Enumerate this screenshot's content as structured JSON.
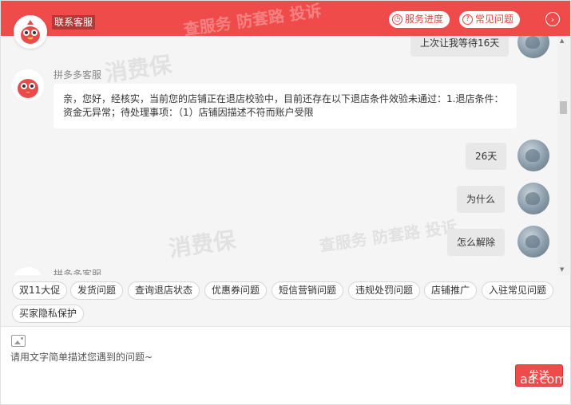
{
  "header": {
    "title": "联系客服",
    "service_progress": "服务进度",
    "faq": "常见问题"
  },
  "messages": [
    {
      "side": "right",
      "text": "上次让我等待16天"
    },
    {
      "side": "left",
      "name": "拼多多客服",
      "text": "亲，您好，经核实，当前您的店铺正在退店校验中，目前还存在以下退店条件效验未通过：1.退店条件：资金无异常；待处理事项：（1）店铺因描述不符而账户受限"
    },
    {
      "side": "right",
      "text": "26天"
    },
    {
      "side": "right",
      "text": "为什么"
    },
    {
      "side": "right",
      "text": "怎么解除"
    },
    {
      "side": "left",
      "name": "拼多多客服",
      "text": ""
    }
  ],
  "tags": [
    "双11大促",
    "发货问题",
    "查询退店状态",
    "优惠券问题",
    "短信营销问题",
    "违规处罚问题",
    "店铺推广",
    "入驻常见问题",
    "买家隐私保护"
  ],
  "input": {
    "placeholder": "请用文字简单描述您遇到的问题~",
    "send_label": "发送"
  },
  "watermark": {
    "text_a": "消费保",
    "text_b": "查服务 防套路 投诉",
    "text_c": "aa.com"
  },
  "colors": {
    "brand": "#f04b4b",
    "bubble_right": "#e8e8e8",
    "bubble_left": "#ffffff"
  },
  "icons": {
    "service_progress": "clock-icon",
    "faq": "question-icon",
    "collapse": "chevron-right-icon",
    "image_upload": "image-icon"
  }
}
